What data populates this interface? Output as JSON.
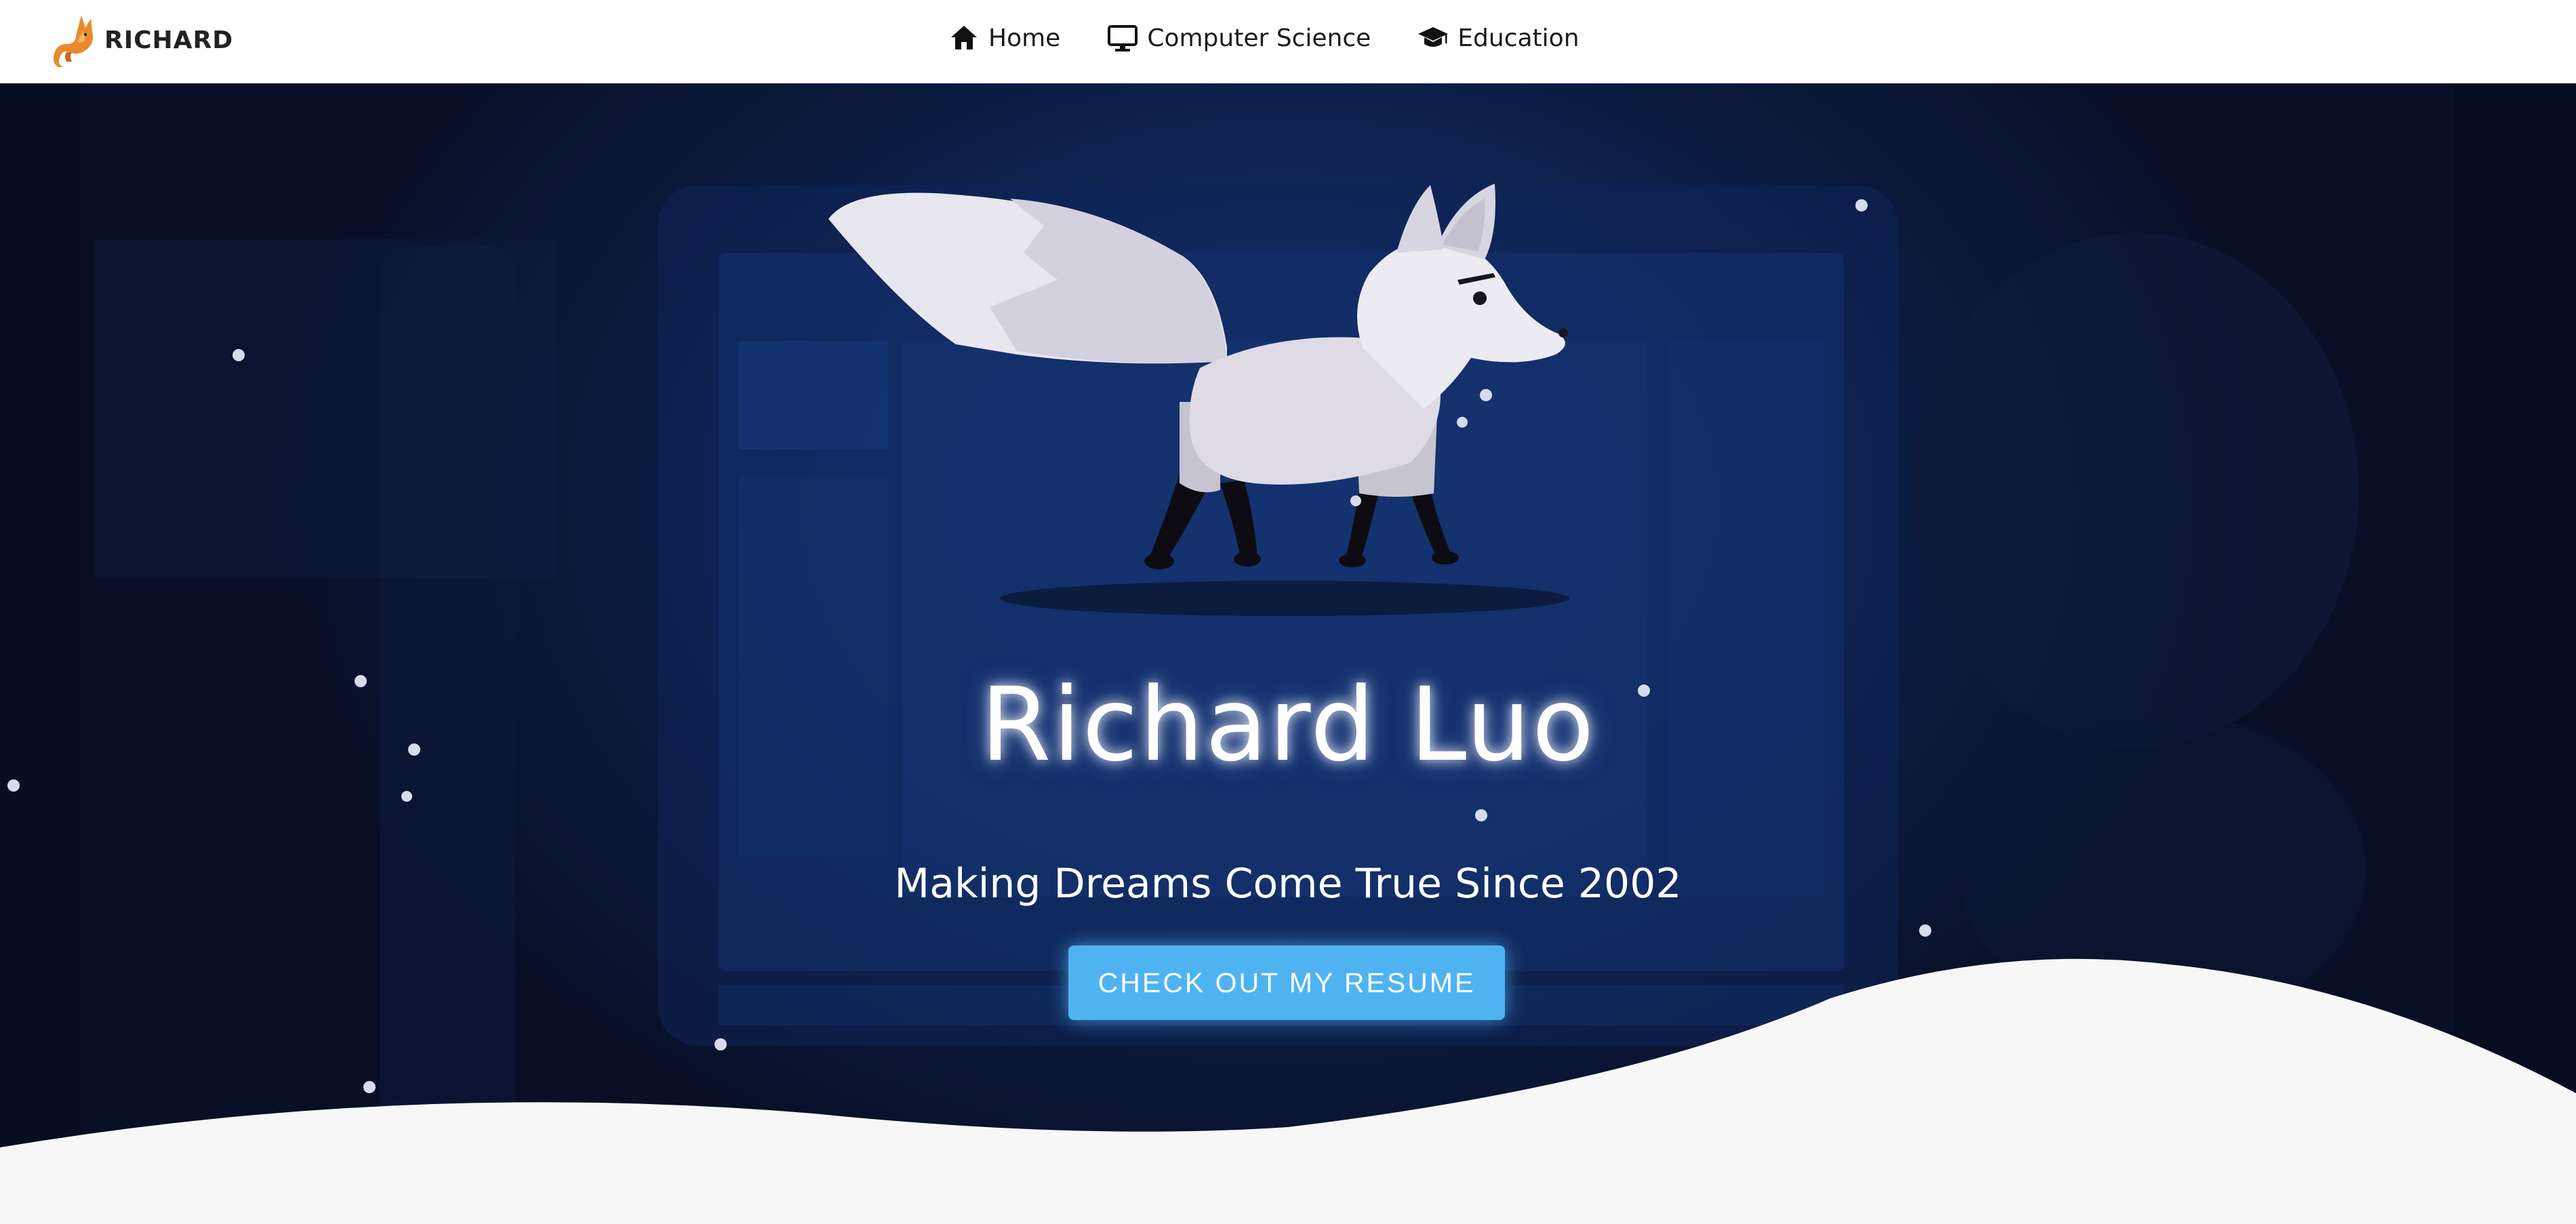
{
  "navbar": {
    "brand": {
      "name": "RICHARD",
      "icon": "fox-logo-icon"
    },
    "links": [
      {
        "label": "Home",
        "icon": "home-icon"
      },
      {
        "label": "Computer Science",
        "icon": "monitor-icon"
      },
      {
        "label": "Education",
        "icon": "graduation-cap-icon"
      }
    ]
  },
  "hero": {
    "title": "Richard Luo",
    "subtitle": "Making Dreams Come True Since 2002",
    "cta_label": "CHECK OUT MY RESUME",
    "illustration": "arctic-fox-illustration"
  },
  "colors": {
    "accent": "#4fb3f2",
    "hero_background": "#112a60",
    "navbar_background": "#ffffff",
    "wave": "#f7f7f7"
  }
}
